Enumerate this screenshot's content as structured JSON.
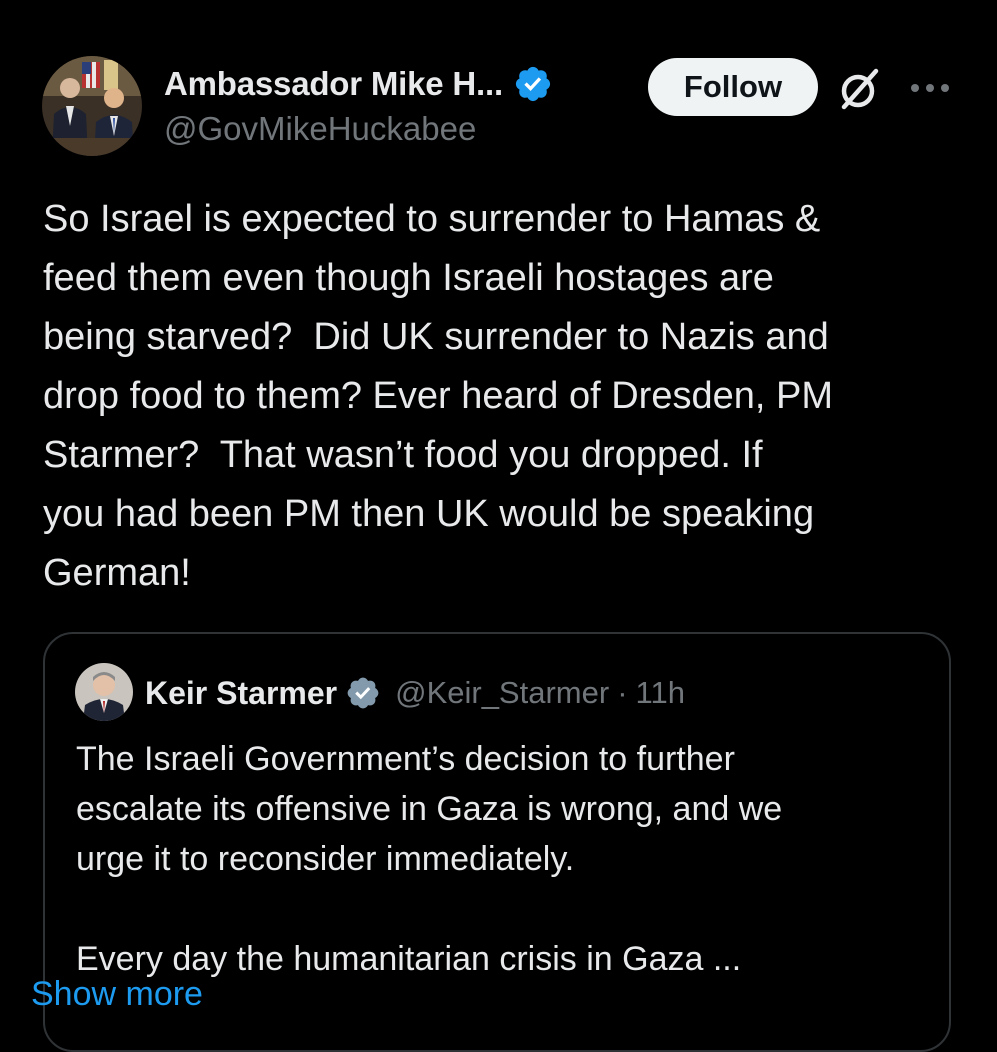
{
  "tweet": {
    "author": {
      "display_name": "Ambassador Mike H...",
      "handle": "@GovMikeHuckabee",
      "verified_icon": "verified-badge-icon"
    },
    "follow_label": "Follow",
    "grok_icon": "grok-icon",
    "more_icon": "more-icon",
    "text": "So Israel is expected to surrender to Hamas &\nfeed them even though Israeli hostages are\nbeing starved?  Did UK surrender to Nazis and\ndrop food to them? Ever heard of Dresden, PM\nStarmer?  That wasn’t food you dropped. If\nyou had been PM then UK would be speaking\nGerman!"
  },
  "quote": {
    "author": {
      "display_name": "Keir Starmer",
      "handle": "@Keir_Starmer",
      "verified_icon": "verified-gray-badge-icon"
    },
    "separator": "·",
    "time": "11h",
    "text": "The Israeli Government’s decision to further\nescalate its offensive in Gaza is wrong, and we\nurge it to reconsider immediately.\n\nEvery day the humanitarian crisis in Gaza ...",
    "show_more_label": "Show more"
  },
  "colors": {
    "background": "#000000",
    "text_primary": "#e7e9ea",
    "text_secondary": "#71767b",
    "verified_blue": "#1d9bf0",
    "verified_gray": "#829aab",
    "link_blue": "#1d9bf0",
    "border": "#2f3336",
    "follow_bg": "#eff3f4"
  }
}
